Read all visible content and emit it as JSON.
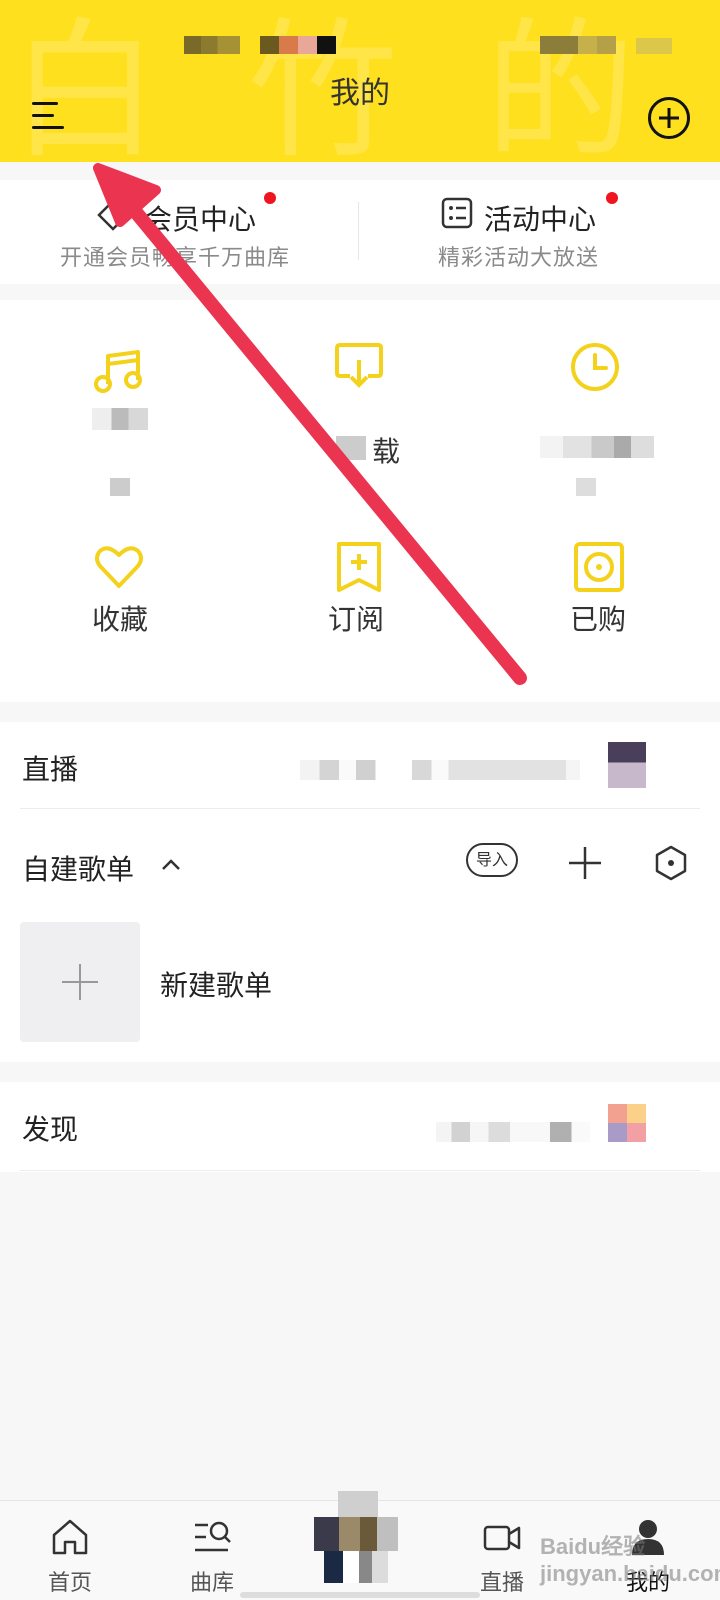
{
  "header": {
    "title": "我的",
    "watermark": "白 竹 的",
    "accent": "#ffe01f"
  },
  "member_row": {
    "vip": {
      "title": "会员中心",
      "subtitle": "开通会员畅享千万曲库"
    },
    "activity": {
      "title": "活动中心",
      "subtitle": "精彩活动大放送"
    }
  },
  "grid": {
    "items": [
      {
        "label": "",
        "icon": "music-note-icon"
      },
      {
        "label": "载",
        "icon": "download-icon"
      },
      {
        "label": "",
        "icon": "clock-icon"
      },
      {
        "label": "收藏",
        "icon": "heart-icon"
      },
      {
        "label": "订阅",
        "icon": "bookmark-plus-icon"
      },
      {
        "label": "已购",
        "icon": "purchased-disc-icon"
      }
    ]
  },
  "sections": {
    "live": {
      "title": "直播"
    },
    "playlists": {
      "title": "自建歌单",
      "import_label": "导入",
      "new_playlist_label": "新建歌单"
    },
    "discover": {
      "title": "发现"
    }
  },
  "nav": {
    "items": [
      {
        "label": "首页",
        "icon": "home-icon"
      },
      {
        "label": "曲库",
        "icon": "library-search-icon"
      },
      {
        "label": "直播",
        "icon": "video-camera-icon"
      },
      {
        "label": "我的",
        "icon": "profile-icon"
      }
    ]
  },
  "watermark_text": "Baidu经验 jingyan.baidu.com"
}
